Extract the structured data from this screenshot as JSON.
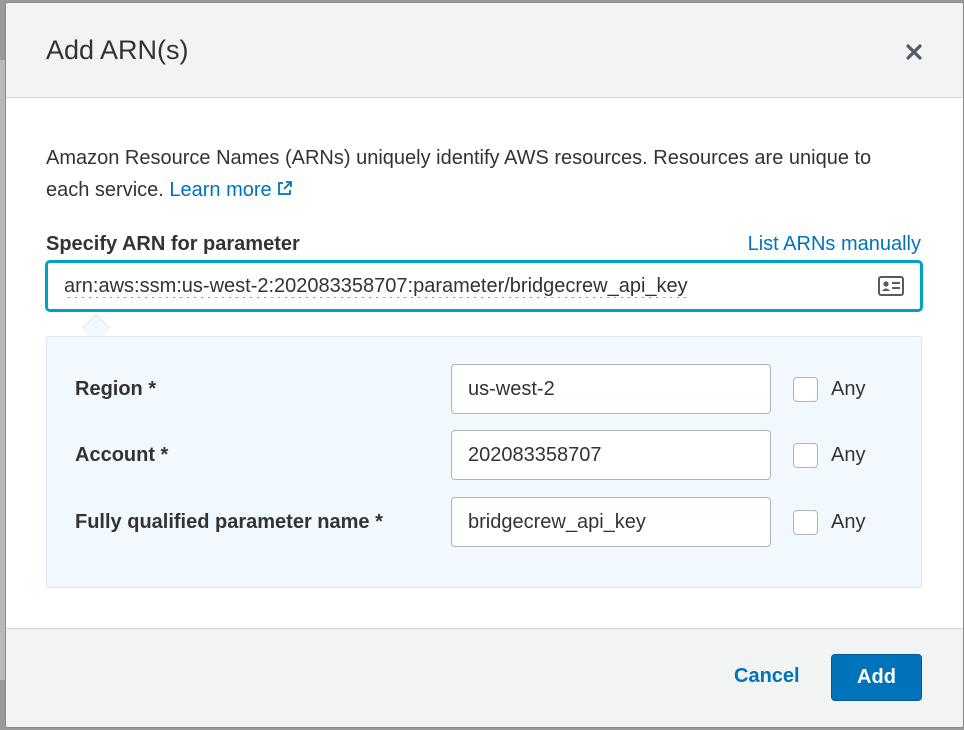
{
  "modal": {
    "title": "Add ARN(s)",
    "close_icon": "close-icon"
  },
  "description": {
    "text": "Amazon Resource Names (ARNs) uniquely identify AWS resources. Resources are unique to each service.",
    "learn_more": "Learn more",
    "learn_more_icon": "external-link-icon"
  },
  "arn_field": {
    "label": "Specify ARN for parameter",
    "list_manual_link": "List ARNs manually",
    "value": "arn:aws:ssm:us-west-2:202083358707:parameter/bridgecrew_api_key",
    "icon": "id-card-icon"
  },
  "builder": {
    "rows": [
      {
        "label": "Region *",
        "value": "us-west-2",
        "any_label": "Any",
        "any_checked": false
      },
      {
        "label": "Account *",
        "value": "202083358707",
        "any_label": "Any",
        "any_checked": false
      },
      {
        "label": "Fully qualified parameter name *",
        "value": "bridgecrew_api_key",
        "any_label": "Any",
        "any_checked": false
      }
    ]
  },
  "footer": {
    "cancel_label": "Cancel",
    "add_label": "Add"
  },
  "colors": {
    "link": "#0073bb",
    "focus_border": "#00a1c9",
    "primary_button": "#0073bb",
    "builder_bg": "#f1f8fe"
  }
}
